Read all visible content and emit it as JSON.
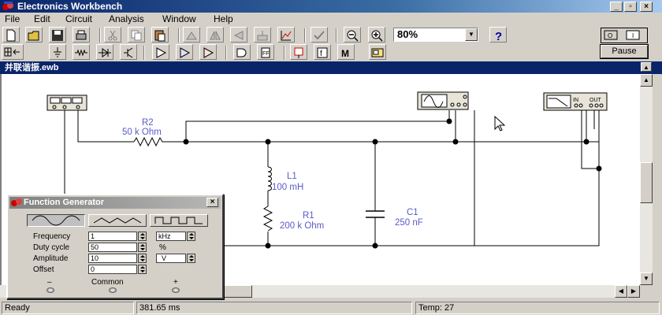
{
  "app": {
    "title": "Electronics Workbench"
  },
  "menu": {
    "items": [
      "File",
      "Edit",
      "Circuit",
      "Analysis",
      "Window",
      "Help"
    ]
  },
  "toolbar": {
    "zoom_value": "80%",
    "pause_label": "Pause"
  },
  "document": {
    "title": "并联谐振.ewb"
  },
  "circuit": {
    "r2_name": "R2",
    "r2_value": "50 k Ohm",
    "l1_name": "L1",
    "l1_value": "100 mH",
    "r1_name": "R1",
    "r1_value": "200 k Ohm",
    "c1_name": "C1",
    "c1_value": "250 nF",
    "bode_in_label": "IN",
    "bode_out_label": "OUT"
  },
  "function_generator": {
    "title": "Function Generator",
    "fields": [
      {
        "label": "Frequency",
        "value": "1",
        "unit": "kHz"
      },
      {
        "label": "Duty cycle",
        "value": "50",
        "unit": "%"
      },
      {
        "label": "Amplitude",
        "value": "10",
        "unit": "V"
      },
      {
        "label": "Offset",
        "value": "0",
        "unit": ""
      }
    ],
    "terminals": {
      "minus": "–",
      "common": "Common",
      "plus": "+"
    }
  },
  "status": {
    "state": "Ready",
    "time": "381.65 ms",
    "temp": "Temp:  27"
  },
  "colors": {
    "title_active": "#0a246a",
    "component_label": "#5a5ac8"
  }
}
